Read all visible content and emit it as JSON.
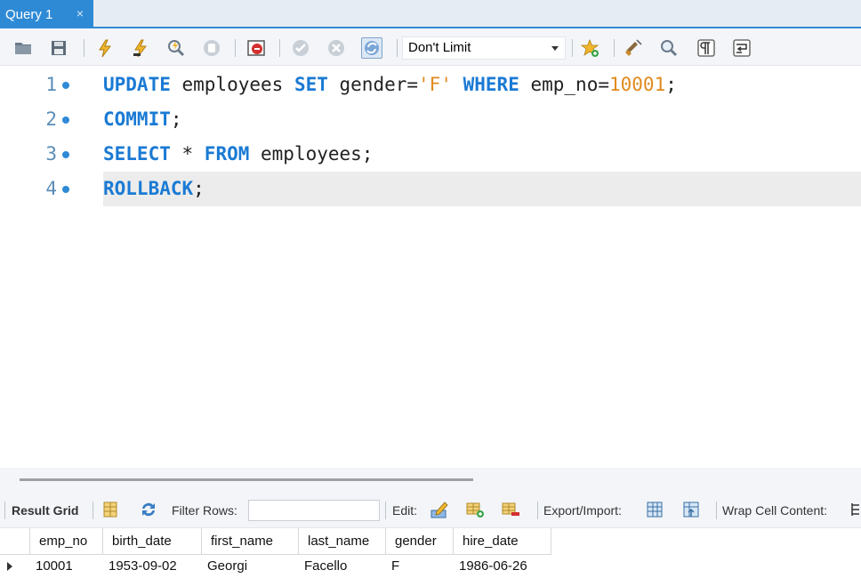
{
  "tabs": [
    {
      "label": "Query 1",
      "close": "×",
      "active": true
    }
  ],
  "toolbar": {
    "icons": [
      "open-folder-icon",
      "save-icon",
      "execute-all-icon",
      "execute-current-icon",
      "explain-icon",
      "stop-icon",
      "toggle-error-stop-icon",
      "commit-icon",
      "rollback-icon",
      "toggle-autocommit-icon",
      "add-bookmark-icon",
      "beautify-icon",
      "find-icon",
      "invisible-chars-icon",
      "wrap-lines-icon"
    ],
    "limit_value": "Don't Limit"
  },
  "editor": {
    "lines": [
      {
        "number": "1",
        "tokens": [
          {
            "t": "kw",
            "v": "UPDATE"
          },
          {
            "t": "txt",
            "v": " employees "
          },
          {
            "t": "kw",
            "v": "SET"
          },
          {
            "t": "txt",
            "v": " gender="
          },
          {
            "t": "str",
            "v": "'F'"
          },
          {
            "t": "txt",
            "v": " "
          },
          {
            "t": "kw",
            "v": "WHERE"
          },
          {
            "t": "txt",
            "v": " emp_no="
          },
          {
            "t": "num",
            "v": "10001"
          },
          {
            "t": "txt",
            "v": ";"
          }
        ]
      },
      {
        "number": "2",
        "tokens": [
          {
            "t": "kw",
            "v": "COMMIT"
          },
          {
            "t": "txt",
            "v": ";"
          }
        ]
      },
      {
        "number": "3",
        "tokens": [
          {
            "t": "kw",
            "v": "SELECT"
          },
          {
            "t": "txt",
            "v": " * "
          },
          {
            "t": "kw",
            "v": "FROM"
          },
          {
            "t": "txt",
            "v": " employees;"
          }
        ]
      },
      {
        "number": "4",
        "tokens": [
          {
            "t": "kw",
            "v": "ROLLBACK"
          },
          {
            "t": "txt",
            "v": ";"
          }
        ],
        "current": true
      }
    ]
  },
  "result_toolbar": {
    "result_grid_label": "Result Grid",
    "filter_label": "Filter Rows:",
    "filter_value": "",
    "edit_label": "Edit:",
    "export_label": "Export/Import:",
    "wrap_label": "Wrap Cell Content:"
  },
  "grid": {
    "columns": [
      "emp_no",
      "birth_date",
      "first_name",
      "last_name",
      "gender",
      "hire_date"
    ],
    "rows": [
      [
        "10001",
        "1953-09-02",
        "Georgi",
        "Facello",
        "F",
        "1986-06-26"
      ]
    ]
  },
  "colors": {
    "accent": "#2f8ad6",
    "keyword": "#1a7ad4",
    "literal": "#e08a1e"
  }
}
